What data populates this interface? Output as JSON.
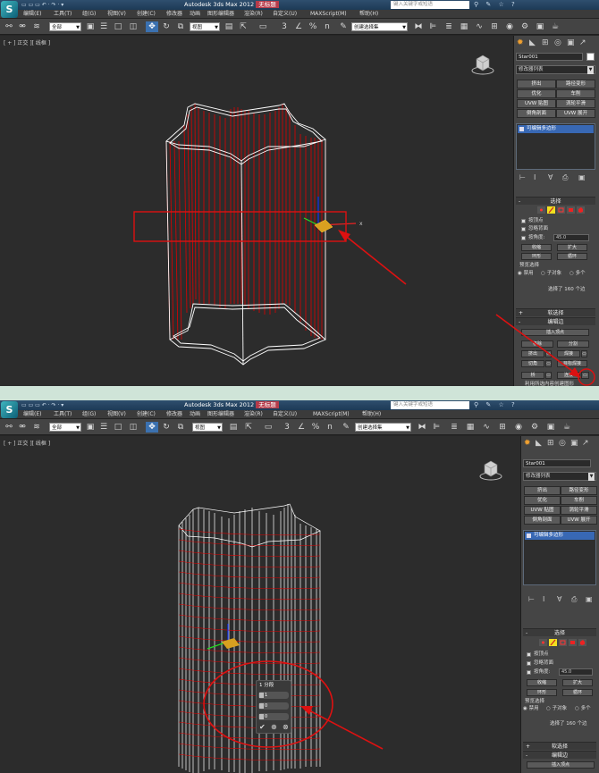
{
  "app": {
    "title": "Autodesk 3ds Max  2012",
    "document_label": "无标题",
    "logo_char": "S",
    "search_placeholder": "键入关键字或短语",
    "search_placeholder_2": "键入关键字或短语"
  },
  "menus": [
    "编辑(E)",
    "工具(T)",
    "组(G)",
    "视图(V)",
    "创建(C)",
    "修改器",
    "动画",
    "图形编辑器",
    "渲染(R)",
    "自定义(U)",
    "MAXScript(M)",
    "帮助(H)"
  ],
  "toolbar": {
    "filter_select": "全部",
    "view_select": "视图",
    "selection_set": "创建选择集",
    "snap_labels": [
      "3",
      "%",
      "n"
    ]
  },
  "viewport": {
    "label": "[ + ] 正交 ][ 线框 ]",
    "gizmo_axis_x": "x"
  },
  "command_panel": {
    "object_name": "Star001",
    "modifier_list": "修改器列表",
    "buttons": [
      "挤出",
      "路径变形",
      "优化",
      "车削",
      "UVW 贴图",
      "涡轮平滑",
      "倒角剖面",
      "UVW 展开"
    ],
    "stack_item": "可编辑多边形",
    "selection": {
      "title": "选择",
      "by_vertex": "按顶点",
      "ignore_backfacing": "忽略背面",
      "by_angle": "按角度:",
      "angle_value": "45.0",
      "shrink": "收缩",
      "grow": "扩大",
      "ring": "环形",
      "loop": "循环",
      "preview": "预览选择",
      "preview_off": "禁用",
      "preview_sub": "子对象",
      "preview_multi": "多个",
      "status": "选择了 160 个边"
    },
    "soft_selection": "软选择",
    "edit_edges": {
      "title": "编辑边",
      "insert_vertex": "插入顶点",
      "remove": "移除",
      "split": "分割",
      "extrude": "挤出",
      "weld": "焊接",
      "chamfer": "切角",
      "target_weld": "目标焊接",
      "bridge": "桥",
      "connect": "连接",
      "create_shape": "利用所选内容创建图形"
    }
  },
  "caddy": {
    "title": "1 分段",
    "values": [
      "1",
      "0",
      "0"
    ]
  },
  "colors": {
    "wire_selected": "#e00000",
    "wire_white": "#ffffff",
    "annotation_red": "#dd1111",
    "title_blue": "#1d3a56",
    "stack_blue": "#3868b4"
  }
}
